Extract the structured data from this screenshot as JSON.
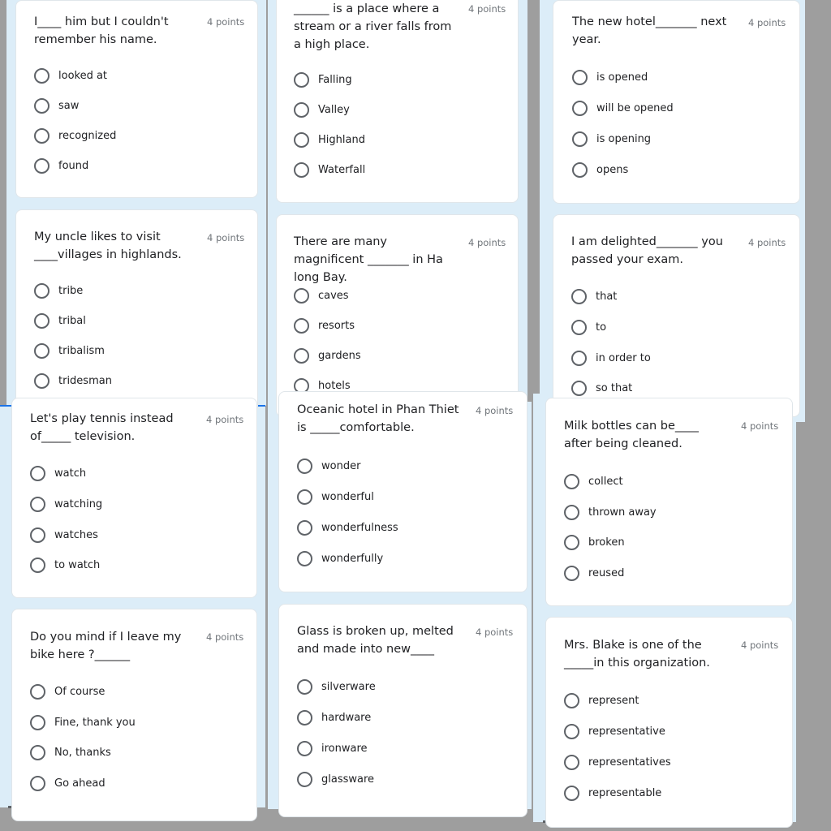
{
  "points_label": "4 points",
  "questions": [
    {
      "title": "I____ him but I couldn't remember his name.",
      "options": [
        "looked at",
        "saw",
        "recognized",
        "found"
      ]
    },
    {
      "title": "______ is a place where a stream or a river falls from a high place.",
      "options": [
        "Falling",
        "Valley",
        "Highland",
        "Waterfall"
      ]
    },
    {
      "title": "The new hotel_______ next year.",
      "options": [
        "is opened",
        "will be opened",
        "is opening",
        "opens"
      ]
    },
    {
      "title": "My uncle likes to visit ____villages in highlands.",
      "options": [
        "tribe",
        "tribal",
        "tribalism",
        "tridesman"
      ]
    },
    {
      "title": "There are many magnificent _______ in Ha long Bay.",
      "options": [
        "caves",
        "resorts",
        "gardens",
        "hotels"
      ]
    },
    {
      "title": "I am delighted_______ you passed your exam.",
      "options": [
        "that",
        "to",
        "in order to",
        "so that"
      ]
    },
    {
      "title": "Let's play tennis instead of_____ television.",
      "options": [
        "watch",
        "watching",
        "watches",
        "to watch"
      ]
    },
    {
      "title": "Oceanic hotel in Phan Thiet is _____comfortable.",
      "options": [
        "wonder",
        "wonderful",
        "wonderfulness",
        "wonderfully"
      ]
    },
    {
      "title": "Milk bottles can be____ after being cleaned.",
      "options": [
        "collect",
        "thrown away",
        "broken",
        "reused"
      ]
    },
    {
      "title": "Do you mind if I leave my bike here ?______",
      "options": [
        "Of course",
        "Fine, thank you",
        "No, thanks",
        "Go ahead"
      ]
    },
    {
      "title": "Glass is broken up, melted and made into new____",
      "options": [
        "silverware",
        "hardware",
        "ironware",
        "glassware"
      ]
    },
    {
      "title": "Mrs. Blake is one of the _____in this organization.",
      "options": [
        "represent",
        "representative",
        "representatives",
        "representable"
      ]
    }
  ]
}
